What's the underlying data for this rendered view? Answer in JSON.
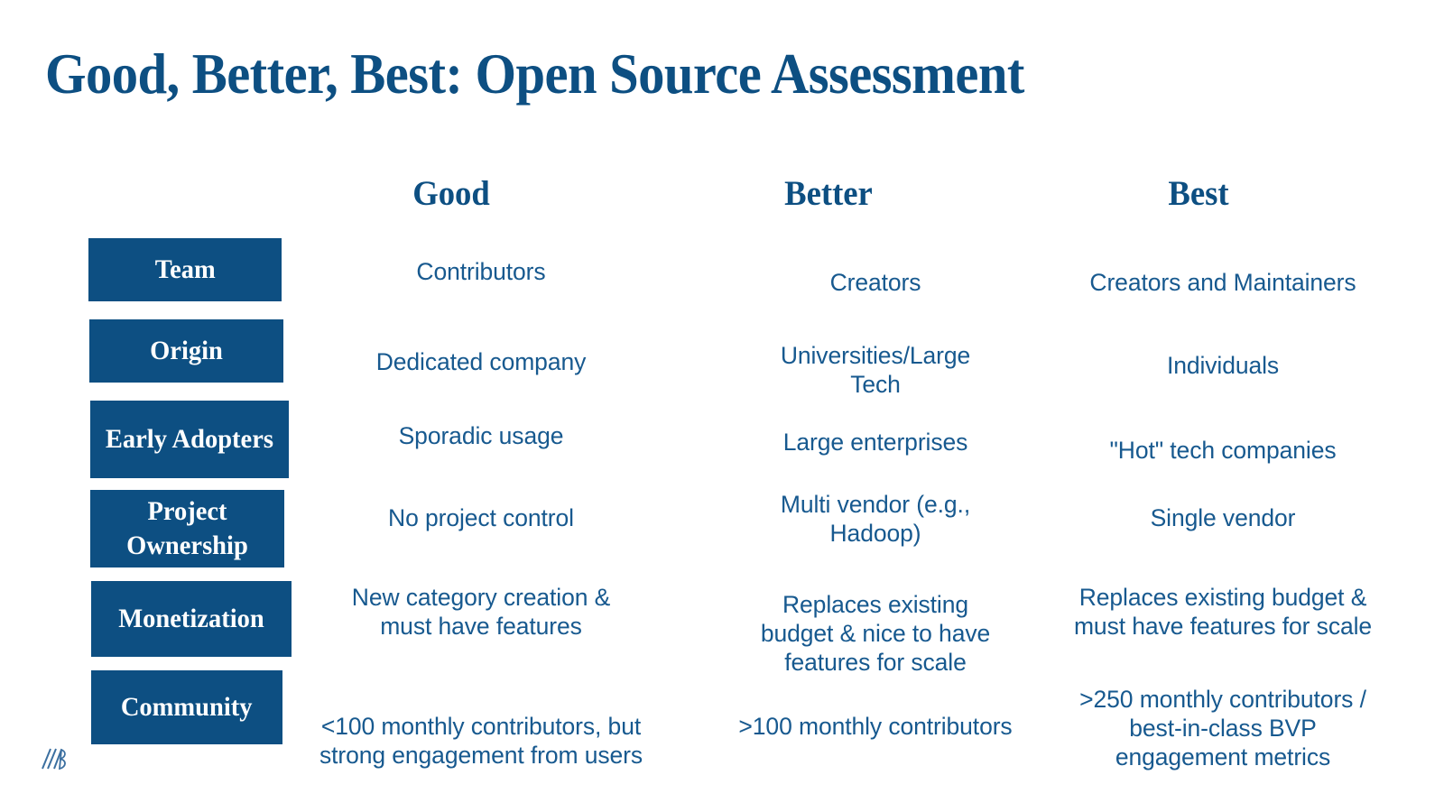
{
  "slide": {
    "title": "Good, Better, Best: Open Source Assessment",
    "background_color": "#ffffff",
    "brand_color": "#0d4f82",
    "body_text_color": "#17598f",
    "logo_name": "bvp-logo-mark"
  },
  "columns": [
    {
      "id": "good",
      "label": "Good"
    },
    {
      "id": "better",
      "label": "Better"
    },
    {
      "id": "best",
      "label": "Best"
    }
  ],
  "rows": [
    {
      "id": "team",
      "label": "Team",
      "good": "Contributors",
      "better": "Creators",
      "best": "Creators and Maintainers"
    },
    {
      "id": "origin",
      "label": "Origin",
      "good": "Dedicated company",
      "better": "Universities/Large\nTech",
      "best": "Individuals"
    },
    {
      "id": "early-adopters",
      "label": "Early\nAdopters",
      "good": "Sporadic usage",
      "better": "Large enterprises",
      "best": "\"Hot\" tech companies"
    },
    {
      "id": "project-ownership",
      "label": "Project\nOwnership",
      "good": "No project control",
      "better": "Multi vendor (e.g.,\nHadoop)",
      "best": "Single vendor"
    },
    {
      "id": "monetization",
      "label": "Monetization",
      "good": "New category creation &\nmust have features",
      "better": "Replaces existing\nbudget & nice to have\nfeatures for scale",
      "best": "Replaces existing budget &\nmust have features for scale"
    },
    {
      "id": "community",
      "label": "Community",
      "good": "<100 monthly contributors, but\nstrong engagement from users",
      "better": ">100 monthly contributors",
      "best": ">250 monthly contributors /\nbest-in-class BVP\nengagement metrics"
    }
  ]
}
